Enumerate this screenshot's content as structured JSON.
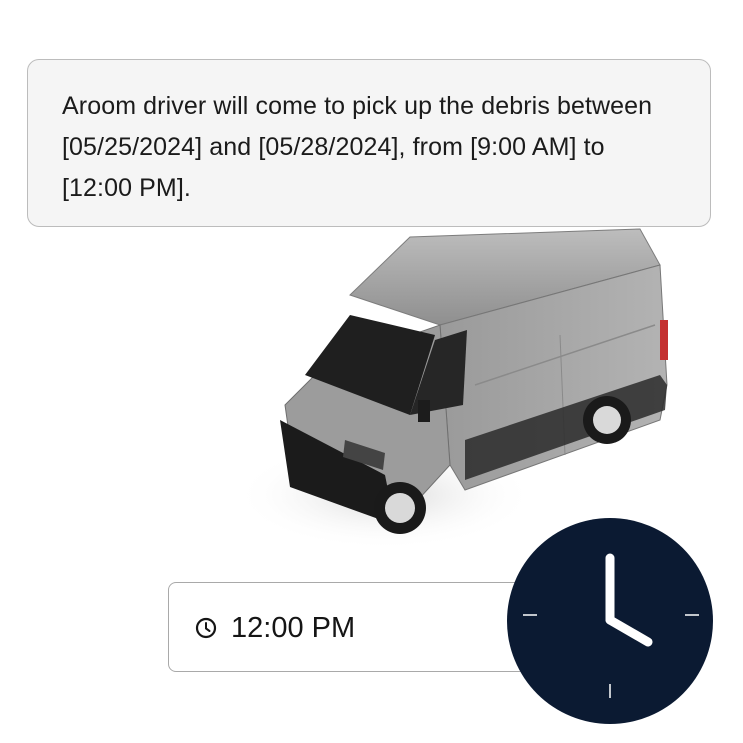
{
  "message": {
    "text": "Aroom driver will come to pick up the debris between [05/25/2024] and [05/28/2024], from [9:00 AM] to [12:00 PM]."
  },
  "illustration": {
    "icon": "delivery-van"
  },
  "time_picker": {
    "value": "12:00 PM",
    "icon": "clock-outline-icon"
  },
  "clock_badge": {
    "icon": "clock-face-icon",
    "colors": {
      "face": "#0b1a32",
      "hands": "#ffffff"
    }
  }
}
